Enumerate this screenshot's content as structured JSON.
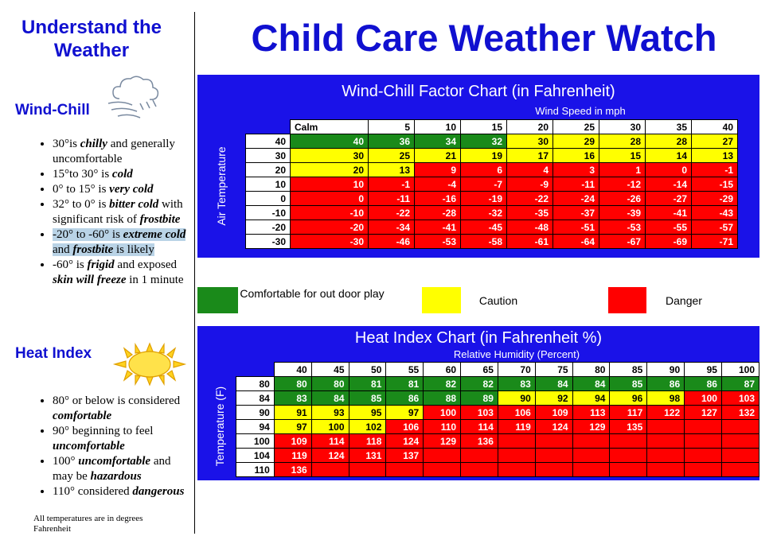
{
  "sidebar": {
    "title_line1": "Understand the",
    "title_line2": "Weather",
    "wind_chill": {
      "heading": "Wind-Chill",
      "icon": "wind-cloud-icon",
      "items": [
        {
          "pre": "30°is ",
          "em": "chilly",
          "post": " and generally uncomfortable",
          "highlight": false
        },
        {
          "pre": "15°to 30° is ",
          "em": "cold",
          "post": "",
          "highlight": false
        },
        {
          "pre": "0° to 15° is ",
          "em": "very cold",
          "post": "",
          "highlight": false
        },
        {
          "pre": "32° to 0° is ",
          "em": "bitter cold",
          "post": " with significant risk of ",
          "em2": "frostbite",
          "highlight": false
        },
        {
          "pre": "-20° to -60° is ",
          "em": "extreme cold",
          "post": " and ",
          "em2": "frostbite",
          "post2": " is likely",
          "highlight": true
        },
        {
          "pre": "-60° is ",
          "em": "frigid",
          "post": " and exposed ",
          "em2": "skin will freeze",
          "post2": " in 1 minute",
          "highlight": false
        }
      ]
    },
    "heat_index": {
      "heading": "Heat Index",
      "icon": "sun-icon",
      "items": [
        {
          "pre": "80° or below is considered ",
          "em": "comfortable",
          "post": ""
        },
        {
          "pre": "90° beginning to feel ",
          "em": "uncomfortable",
          "post": ""
        },
        {
          "pre": "100° ",
          "em": "uncomfortable",
          "post": " and may be ",
          "em2": "hazardous"
        },
        {
          "pre": "110° considered ",
          "em": "dangerous",
          "post": ""
        }
      ]
    },
    "footnote": "All temperatures are in degrees Fahrenheit"
  },
  "main_title": "Child Care Weather Watch",
  "wind_chart": {
    "title": "Wind-Chill Factor Chart (in Fahrenheit)",
    "subtitle": "Wind Speed in mph",
    "axis_label": "Air Temperature",
    "columns": [
      "Calm",
      "5",
      "10",
      "15",
      "20",
      "25",
      "30",
      "35",
      "40"
    ],
    "rows": [
      {
        "t": "40",
        "v": [
          "40",
          "36",
          "34",
          "32",
          "30",
          "29",
          "28",
          "28",
          "27"
        ],
        "c": [
          "g",
          "g",
          "g",
          "g",
          "y",
          "y",
          "y",
          "y",
          "y"
        ]
      },
      {
        "t": "30",
        "v": [
          "30",
          "25",
          "21",
          "19",
          "17",
          "16",
          "15",
          "14",
          "13"
        ],
        "c": [
          "y",
          "y",
          "y",
          "y",
          "y",
          "y",
          "y",
          "y",
          "y"
        ]
      },
      {
        "t": "20",
        "v": [
          "20",
          "13",
          "9",
          "6",
          "4",
          "3",
          "1",
          "0",
          "-1"
        ],
        "c": [
          "y",
          "y",
          "r",
          "r",
          "r",
          "r",
          "r",
          "r",
          "r"
        ]
      },
      {
        "t": "10",
        "v": [
          "10",
          "-1",
          "-4",
          "-7",
          "-9",
          "-11",
          "-12",
          "-14",
          "-15"
        ],
        "c": [
          "r",
          "r",
          "r",
          "r",
          "r",
          "r",
          "r",
          "r",
          "r"
        ]
      },
      {
        "t": "0",
        "v": [
          "0",
          "-11",
          "-16",
          "-19",
          "-22",
          "-24",
          "-26",
          "-27",
          "-29"
        ],
        "c": [
          "r",
          "r",
          "r",
          "r",
          "r",
          "r",
          "r",
          "r",
          "r"
        ]
      },
      {
        "t": "-10",
        "v": [
          "-10",
          "-22",
          "-28",
          "-32",
          "-35",
          "-37",
          "-39",
          "-41",
          "-43"
        ],
        "c": [
          "r",
          "r",
          "r",
          "r",
          "r",
          "r",
          "r",
          "r",
          "r"
        ]
      },
      {
        "t": "-20",
        "v": [
          "-20",
          "-34",
          "-41",
          "-45",
          "-48",
          "-51",
          "-53",
          "-55",
          "-57"
        ],
        "c": [
          "r",
          "r",
          "r",
          "r",
          "r",
          "r",
          "r",
          "r",
          "r"
        ]
      },
      {
        "t": "-30",
        "v": [
          "-30",
          "-46",
          "-53",
          "-58",
          "-61",
          "-64",
          "-67",
          "-69",
          "-71"
        ],
        "c": [
          "r",
          "r",
          "r",
          "r",
          "r",
          "r",
          "r",
          "r",
          "r"
        ]
      }
    ]
  },
  "legend": [
    {
      "label": "Comfortable for out door play",
      "color": "#1a8a1a"
    },
    {
      "label": "Caution",
      "color": "#ffff00"
    },
    {
      "label": "Danger",
      "color": "#ff0000"
    }
  ],
  "heat_chart": {
    "title": "Heat Index Chart (in Fahrenheit %)",
    "subtitle": "Relative Humidity (Percent)",
    "axis_label": "Temperature (F)",
    "columns": [
      "40",
      "45",
      "50",
      "55",
      "60",
      "65",
      "70",
      "75",
      "80",
      "85",
      "90",
      "95",
      "100"
    ],
    "rows": [
      {
        "t": "80",
        "v": [
          "80",
          "80",
          "81",
          "81",
          "82",
          "82",
          "83",
          "84",
          "84",
          "85",
          "86",
          "86",
          "87"
        ],
        "c": [
          "g",
          "g",
          "g",
          "g",
          "g",
          "g",
          "g",
          "g",
          "g",
          "g",
          "g",
          "g",
          "g"
        ]
      },
      {
        "t": "84",
        "v": [
          "83",
          "84",
          "85",
          "86",
          "88",
          "89",
          "90",
          "92",
          "94",
          "96",
          "98",
          "100",
          "103"
        ],
        "c": [
          "g",
          "g",
          "g",
          "g",
          "g",
          "g",
          "y",
          "y",
          "y",
          "y",
          "y",
          "r",
          "r"
        ]
      },
      {
        "t": "90",
        "v": [
          "91",
          "93",
          "95",
          "97",
          "100",
          "103",
          "106",
          "109",
          "113",
          "117",
          "122",
          "127",
          "132"
        ],
        "c": [
          "y",
          "y",
          "y",
          "y",
          "r",
          "r",
          "r",
          "r",
          "r",
          "r",
          "r",
          "r",
          "r"
        ]
      },
      {
        "t": "94",
        "v": [
          "97",
          "100",
          "102",
          "106",
          "110",
          "114",
          "119",
          "124",
          "129",
          "135",
          "",
          "",
          ""
        ],
        "c": [
          "y",
          "y",
          "y",
          "r",
          "r",
          "r",
          "r",
          "r",
          "r",
          "r",
          "r",
          "r",
          "r"
        ]
      },
      {
        "t": "100",
        "v": [
          "109",
          "114",
          "118",
          "124",
          "129",
          "136",
          "",
          "",
          "",
          "",
          "",
          "",
          ""
        ],
        "c": [
          "r",
          "r",
          "r",
          "r",
          "r",
          "r",
          "r",
          "r",
          "r",
          "r",
          "r",
          "r",
          "r"
        ]
      },
      {
        "t": "104",
        "v": [
          "119",
          "124",
          "131",
          "137",
          "",
          "",
          "",
          "",
          "",
          "",
          "",
          "",
          ""
        ],
        "c": [
          "r",
          "r",
          "r",
          "r",
          "r",
          "r",
          "r",
          "r",
          "r",
          "r",
          "r",
          "r",
          "r"
        ]
      },
      {
        "t": "110",
        "v": [
          "136",
          "",
          "",
          "",
          "",
          "",
          "",
          "",
          "",
          "",
          "",
          "",
          ""
        ],
        "c": [
          "r",
          "r",
          "r",
          "r",
          "r",
          "r",
          "r",
          "r",
          "r",
          "r",
          "r",
          "r",
          "r"
        ]
      }
    ]
  }
}
